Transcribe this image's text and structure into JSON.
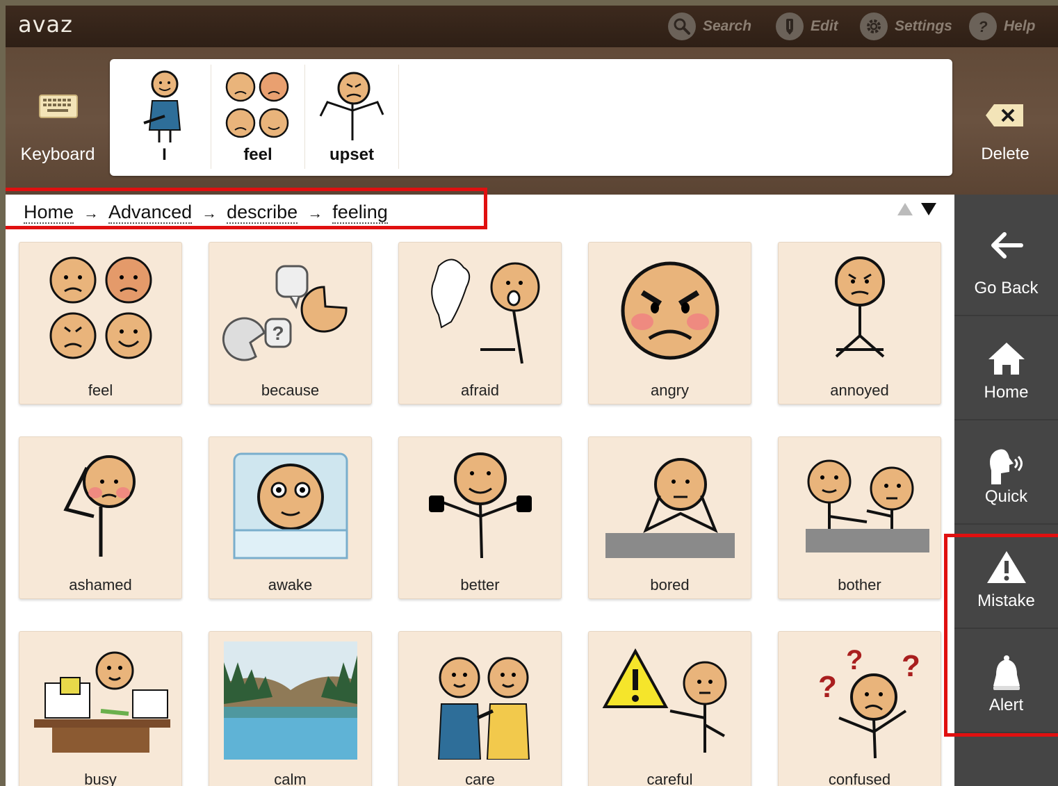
{
  "app": {
    "logo": "avaz"
  },
  "topbar": {
    "search": "Search",
    "edit": "Edit",
    "settings": "Settings",
    "help": "Help"
  },
  "keyboard": {
    "label": "Keyboard"
  },
  "delete": {
    "label": "Delete"
  },
  "sentence": [
    {
      "label": "I",
      "icon": "person-self-icon"
    },
    {
      "label": "feel",
      "icon": "faces-feelings-icon"
    },
    {
      "label": "upset",
      "icon": "upset-person-icon"
    }
  ],
  "breadcrumb": [
    "Home",
    "Advanced",
    "describe",
    "feeling"
  ],
  "breadcrumb_sep": "→",
  "tiles": [
    {
      "label": "feel",
      "icon": "faces-feelings-icon"
    },
    {
      "label": "because",
      "icon": "speech-question-icon"
    },
    {
      "label": "afraid",
      "icon": "ghost-scared-icon"
    },
    {
      "label": "angry",
      "icon": "angry-face-icon"
    },
    {
      "label": "annoyed",
      "icon": "annoyed-person-icon"
    },
    {
      "label": "ashamed",
      "icon": "ashamed-person-icon"
    },
    {
      "label": "awake",
      "icon": "awake-bed-icon"
    },
    {
      "label": "better",
      "icon": "thumbs-up-person-icon"
    },
    {
      "label": "bored",
      "icon": "bored-person-icon"
    },
    {
      "label": "bother",
      "icon": "bother-people-icon"
    },
    {
      "label": "busy",
      "icon": "busy-desk-icon"
    },
    {
      "label": "calm",
      "icon": "lake-landscape-icon"
    },
    {
      "label": "care",
      "icon": "care-people-icon"
    },
    {
      "label": "careful",
      "icon": "warning-person-icon"
    },
    {
      "label": "confused",
      "icon": "confused-person-icon"
    }
  ],
  "sidebar": {
    "go_back": "Go Back",
    "home": "Home",
    "quick": "Quick",
    "mistake": "Mistake",
    "alert": "Alert"
  },
  "colors": {
    "topbar": "#2e1f15",
    "tile_bg": "#f7e8d7",
    "sidebar": "#454545",
    "highlight": "#e01010",
    "skin": "#e9b47b"
  }
}
